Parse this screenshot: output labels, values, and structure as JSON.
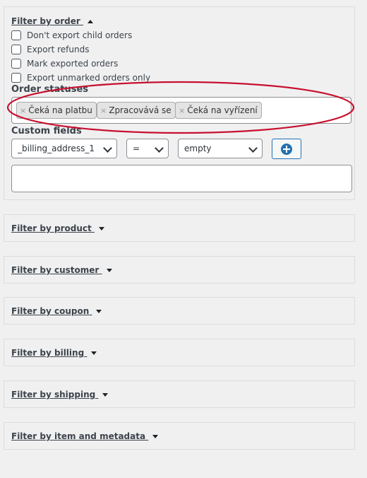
{
  "filter_by_order": {
    "title": "Filter by order",
    "checkboxes": [
      {
        "label": "Don't export child orders",
        "checked": false
      },
      {
        "label": "Export refunds",
        "checked": false
      },
      {
        "label": "Mark exported orders",
        "checked": false
      },
      {
        "label": "Export unmarked orders only",
        "checked": false
      }
    ],
    "order_statuses_label": "Order statuses",
    "order_statuses": [
      "Čeká na platbu",
      "Zpracovává se",
      "Čeká na vyřízení"
    ],
    "tag_remove_symbol": "×",
    "custom_fields_label": "Custom fields",
    "custom_field_select": "_billing_address_1",
    "operator_select": "=",
    "value_select": "empty",
    "custom_fields_text": ""
  },
  "sections": [
    {
      "title": "Filter by product"
    },
    {
      "title": "Filter by customer"
    },
    {
      "title": "Filter by coupon"
    },
    {
      "title": "Filter by billing"
    },
    {
      "title": "Filter by shipping"
    },
    {
      "title": "Filter by item and metadata"
    }
  ],
  "colors": {
    "highlight_ellipse": "#c8102e",
    "add_button_accent": "#2271b1"
  },
  "icons": {
    "expanded": "caret-up-icon",
    "collapsed": "caret-down-icon",
    "add": "plus-circle-icon",
    "dropdown": "chevron-down-icon"
  }
}
